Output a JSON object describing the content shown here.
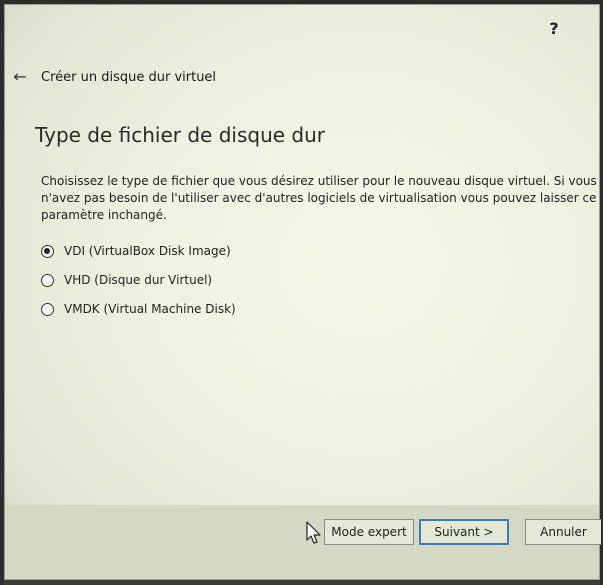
{
  "window": {
    "help_label": "?"
  },
  "header": {
    "title": "Créer un disque dur virtuel"
  },
  "page": {
    "title": "Type de fichier de disque dur",
    "description": "Choisissez le type de fichier que vous désirez utiliser pour le nouveau disque virtuel. Si vous n'avez pas besoin de l'utiliser avec d'autres logiciels de virtualisation vous pouvez laisser ce paramètre inchangé."
  },
  "options": [
    {
      "label": "VDI (VirtualBox Disk Image)",
      "checked": true
    },
    {
      "label": "VHD (Disque dur Virtuel)",
      "checked": false
    },
    {
      "label": "VMDK (Virtual Machine Disk)",
      "checked": false
    }
  ],
  "footer": {
    "expert_label": "Mode expert",
    "next_label": "Suivant >",
    "cancel_label": "Annuler"
  }
}
